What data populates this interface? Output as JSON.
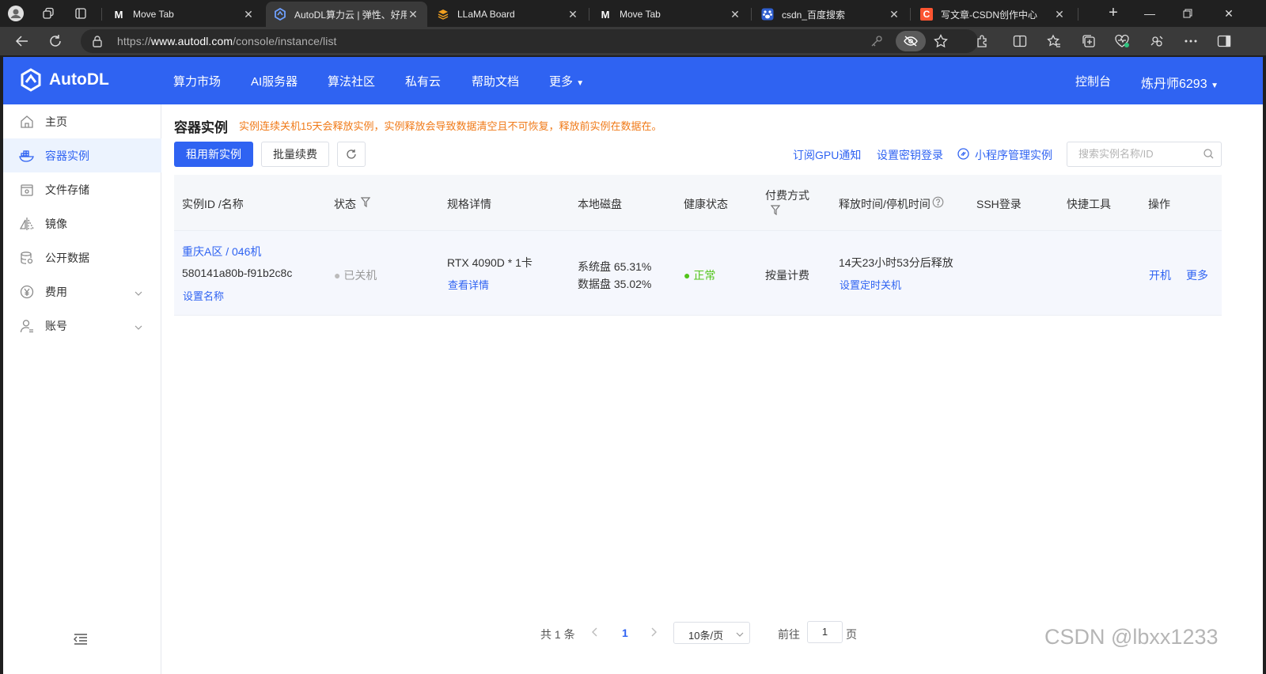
{
  "browser": {
    "tabs": [
      {
        "title": "Move Tab",
        "favicon": "M"
      },
      {
        "title": "AutoDL算力云 | 弹性、好用",
        "favicon": "autodl-logo"
      },
      {
        "title": "LLaMA Board",
        "favicon": "layers"
      },
      {
        "title": "Move Tab",
        "favicon": "M"
      },
      {
        "title": "csdn_百度搜索",
        "favicon": "baidu-paw"
      },
      {
        "title": "写文章-CSDN创作中心",
        "favicon": "C"
      }
    ],
    "url_prefix": "https://",
    "url_host": "www.autodl.com",
    "url_path": "/console/instance/list"
  },
  "site": {
    "logo": "AutoDL",
    "menu": [
      "算力市场",
      "AI服务器",
      "算法社区",
      "私有云",
      "帮助文档",
      "更多"
    ],
    "console": "控制台",
    "user": "炼丹师6293"
  },
  "sidebar": {
    "items": [
      {
        "label": "主页",
        "icon": "home-icon"
      },
      {
        "label": "容器实例",
        "icon": "container-icon"
      },
      {
        "label": "文件存储",
        "icon": "storage-icon"
      },
      {
        "label": "镜像",
        "icon": "image-icon"
      },
      {
        "label": "公开数据",
        "icon": "database-icon"
      },
      {
        "label": "费用",
        "icon": "yen-icon"
      },
      {
        "label": "账号",
        "icon": "user-icon"
      }
    ]
  },
  "main": {
    "title": "容器实例",
    "notice": "实例连续关机15天会释放实例，实例释放会导致数据清空且不可恢复，释放前实例在数据在。",
    "rent_button": "租用新实例",
    "renew_button": "批量续费",
    "gpu_notice_link": "订阅GPU通知",
    "ssh_key_link": "设置密钥登录",
    "miniapp_link": "小程序管理实例",
    "search_placeholder": "搜索实例名称/ID"
  },
  "table": {
    "headers": {
      "id": "实例ID /名称",
      "status": "状态",
      "spec": "规格详情",
      "disk": "本地磁盘",
      "health": "健康状态",
      "pay": "付费方式",
      "release": "释放时间/停机时间",
      "ssh": "SSH登录",
      "tools": "快捷工具",
      "ops": "操作"
    },
    "rows": [
      {
        "name": "重庆A区 / 046机",
        "id": "580141a80b-f91b2c8c",
        "set_name": "设置名称",
        "status": "已关机",
        "spec": "RTX 4090D * 1卡",
        "spec_detail": "查看详情",
        "disk_system": "系统盘 65.31%",
        "disk_data": "数据盘 35.02%",
        "health": "正常",
        "pay": "按量计费",
        "release": "14天23小时53分后释放",
        "set_shutdown": "设置定时关机",
        "op_start": "开机",
        "op_more": "更多"
      }
    ]
  },
  "pagination": {
    "total": "共 1 条",
    "current": "1",
    "page_size": "10条/页",
    "goto_prefix": "前往",
    "goto_value": "1",
    "goto_suffix": "页"
  },
  "watermark": "CSDN @lbxx1233",
  "colors": {
    "accent": "#2f63f2",
    "warning": "#f07a18",
    "success": "#52c41a"
  }
}
